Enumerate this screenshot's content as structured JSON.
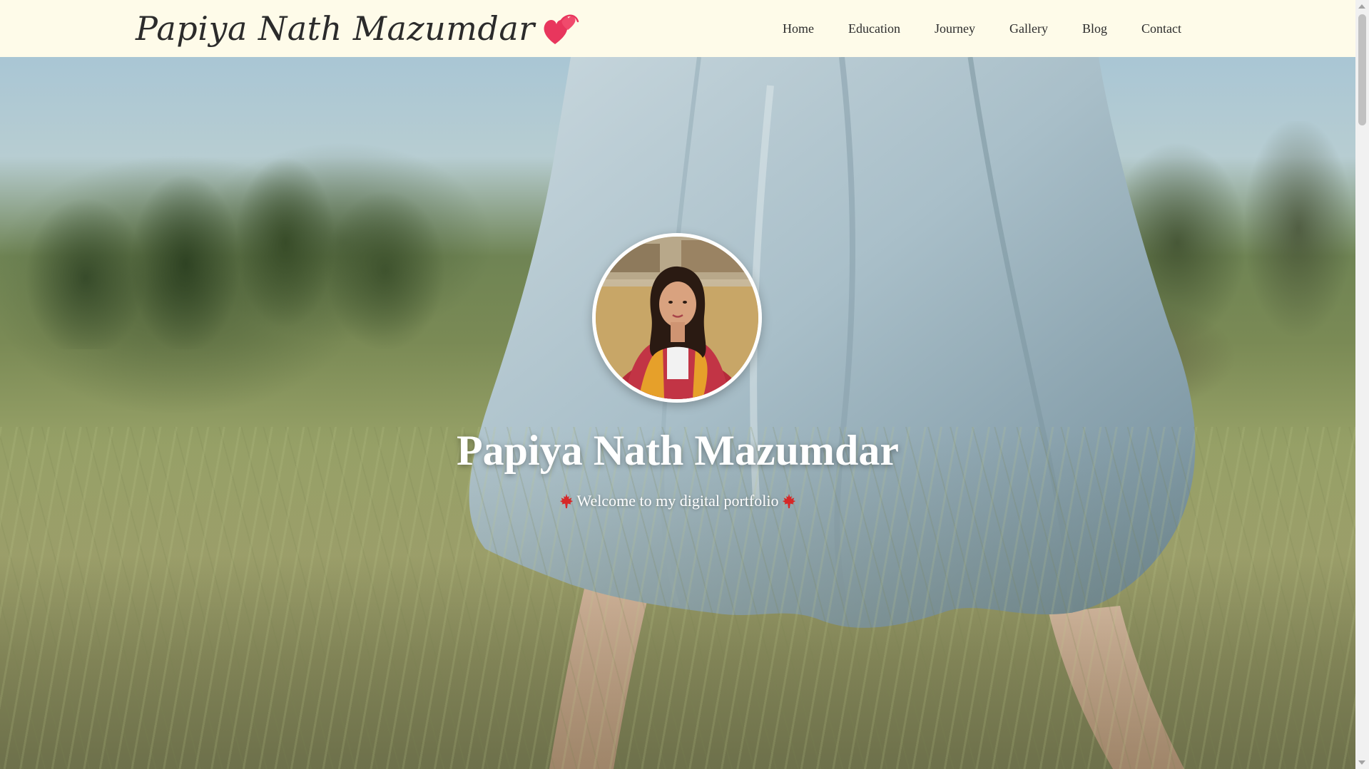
{
  "header": {
    "brand": "Papiya Nath Mazumdar",
    "nav": [
      "Home",
      "Education",
      "Journey",
      "Gallery",
      "Blog",
      "Contact"
    ]
  },
  "hero": {
    "title": "Papiya Nath Mazumdar",
    "subtitle": "Welcome to my digital portfolio"
  },
  "colors": {
    "navbar_bg": "#fefbe9",
    "text_dark": "#2b2b2b",
    "heart": "#e8365d",
    "maple": "#d62828",
    "hero_text": "#ffffff"
  },
  "icons": {
    "brand": "two-hearts-icon",
    "subtitle_left": "maple-leaf-icon",
    "subtitle_right": "maple-leaf-icon"
  }
}
